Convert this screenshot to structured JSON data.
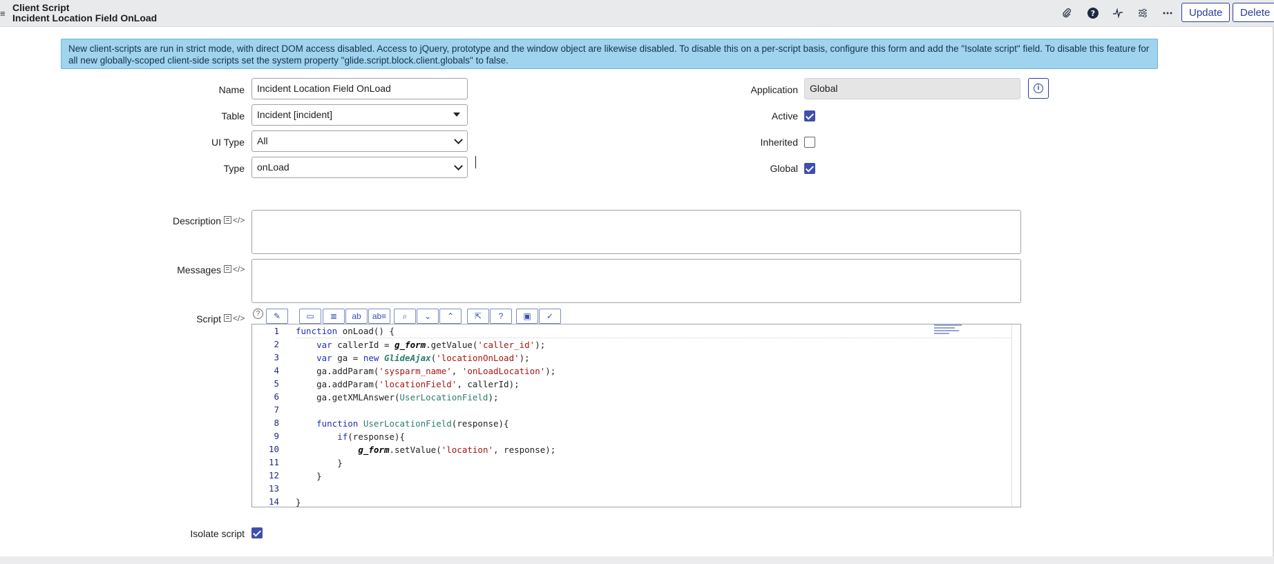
{
  "header": {
    "menu_icon": "≡",
    "record_type": "Client Script",
    "record_name": "Incident Location Field OnLoad",
    "icons": [
      "paperclip-icon",
      "help-icon",
      "activity-icon",
      "settings-icon",
      "more-icon"
    ],
    "update_label": "Update",
    "delete_label": "Delete"
  },
  "banner": {
    "text": "New client-scripts are run in strict mode, with direct DOM access disabled. Access to jQuery, prototype and the window object are likewise disabled. To disable this on a per-script basis, configure this form and add the \"Isolate script\" field. To disable this feature for all new globally-scoped client-side scripts set the system property \"glide.script.block.client.globals\" to false."
  },
  "form": {
    "name": {
      "label": "Name",
      "value": "Incident Location Field OnLoad"
    },
    "table": {
      "label": "Table",
      "value": "Incident [incident]"
    },
    "ui_type": {
      "label": "UI Type",
      "value": "All"
    },
    "type": {
      "label": "Type",
      "value": "onLoad"
    },
    "application": {
      "label": "Application",
      "value": "Global"
    },
    "active": {
      "label": "Active",
      "checked": true
    },
    "inherited": {
      "label": "Inherited",
      "checked": false
    },
    "global": {
      "label": "Global",
      "checked": true
    },
    "description": {
      "label": "Description",
      "value": ""
    },
    "messages": {
      "label": "Messages",
      "value": ""
    },
    "script": {
      "label": "Script"
    },
    "isolate_script": {
      "label": "Isolate script",
      "checked": true
    }
  },
  "toolbar": {
    "help": "?",
    "buttons": [
      "script-include-icon",
      "comment-icon",
      "format-icon",
      "replace-icon",
      "replace-all-icon",
      "search-icon",
      "find-next-icon",
      "find-previous-icon",
      "fullscreen-icon",
      "help-circle-icon",
      "save-icon",
      "syntax-check-icon"
    ]
  },
  "code": {
    "lines": [
      "function onLoad() {",
      "    var callerId = g_form.getValue('caller_id');",
      "    var ga = new GlideAjax('locationOnLoad');",
      "    ga.addParam('sysparm_name', 'onLoadLocation');",
      "    ga.addParam('locationField', callerId);",
      "    ga.getXMLAnswer(UserLocationField);",
      "",
      "    function UserLocationField(response){",
      "        if(response){",
      "            g_form.setValue('location', response);",
      "        }",
      "    }",
      "",
      "}"
    ],
    "colors": {
      "keyword": "#1f2ec2",
      "string": "#a31515",
      "function_name": "#2a7d6c",
      "global": "#000000"
    }
  }
}
